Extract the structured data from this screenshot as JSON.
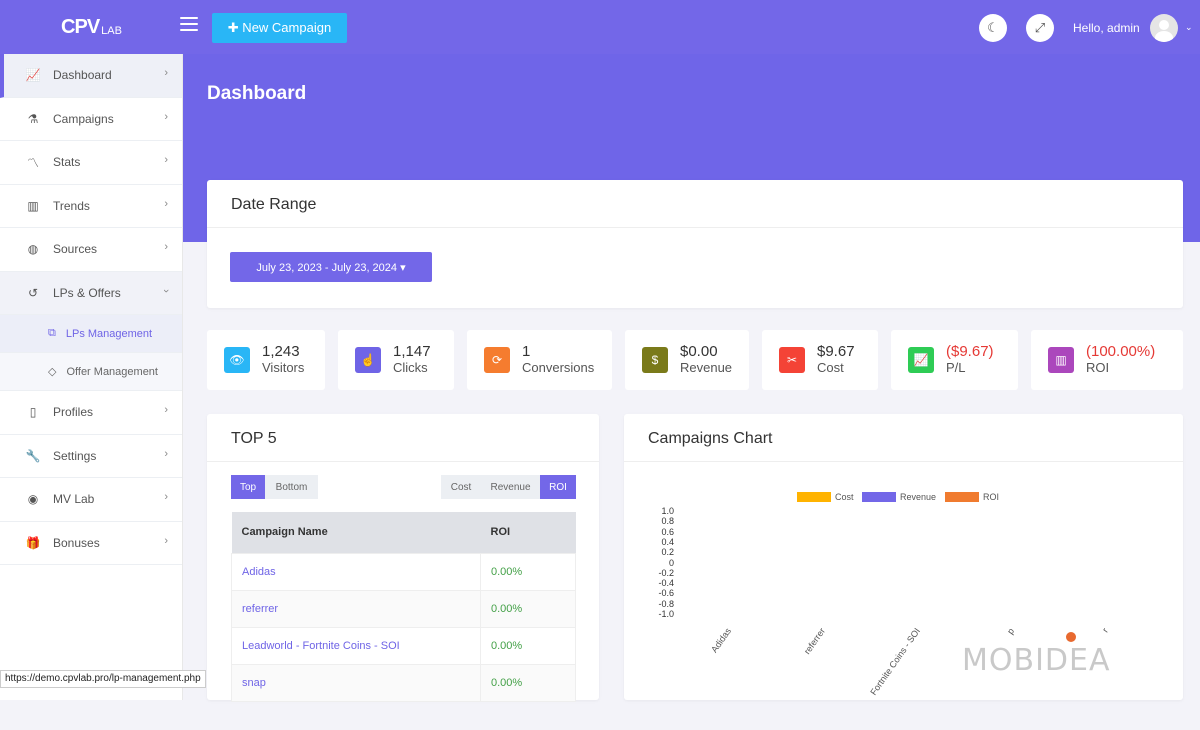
{
  "header": {
    "logo_text": "CPV",
    "logo_sub": "LAB",
    "new_campaign": "✚ New Campaign",
    "greeting": "Hello, admin"
  },
  "sidebar": {
    "items": [
      {
        "label": "Dashboard",
        "icon": "chart-line-icon"
      },
      {
        "label": "Campaigns",
        "icon": "flask-icon"
      },
      {
        "label": "Stats",
        "icon": "stats-icon"
      },
      {
        "label": "Trends",
        "icon": "trends-icon"
      },
      {
        "label": "Sources",
        "icon": "globe-icon"
      },
      {
        "label": "LPs & Offers",
        "icon": "history-icon"
      },
      {
        "label": "Profiles",
        "icon": "clipboard-icon"
      },
      {
        "label": "Settings",
        "icon": "wrench-icon"
      },
      {
        "label": "MV Lab",
        "icon": "mvlab-icon"
      },
      {
        "label": "Bonuses",
        "icon": "gift-icon"
      }
    ],
    "subitems": [
      {
        "label": "LPs Management"
      },
      {
        "label": "Offer Management"
      }
    ]
  },
  "page": {
    "title": "Dashboard"
  },
  "date_range": {
    "title": "Date Range",
    "button": "July 23, 2023 - July 23, 2024 ▾"
  },
  "stats": [
    {
      "value": "1,243",
      "label": "Visitors",
      "color": "#29b6f6"
    },
    {
      "value": "1,147",
      "label": "Clicks",
      "color": "#6f64e6"
    },
    {
      "value": "1",
      "label": "Conversions",
      "color": "#f57c2f"
    },
    {
      "value": "$0.00",
      "label": "Revenue",
      "color": "#7a7a1a"
    },
    {
      "value": "$9.67",
      "label": "Cost",
      "color": "#f44336"
    },
    {
      "value": "($9.67)",
      "label": "P/L",
      "color": "#2ecc55"
    },
    {
      "value": "(100.00%)",
      "label": "ROI",
      "color": "#ab47bc"
    }
  ],
  "top5": {
    "title": "TOP 5",
    "tabs": [
      "Top",
      "Bottom"
    ],
    "metric_tabs": [
      "Cost",
      "Revenue",
      "ROI"
    ],
    "columns": [
      "Campaign Name",
      "ROI"
    ],
    "rows": [
      {
        "name": "Adidas",
        "roi": "0.00%"
      },
      {
        "name": "referrer",
        "roi": "0.00%"
      },
      {
        "name": "Leadworld - Fortnite Coins - SOI",
        "roi": "0.00%"
      },
      {
        "name": "snap",
        "roi": "0.00%"
      }
    ]
  },
  "campaigns_chart": {
    "title": "Campaigns Chart"
  },
  "chart_data": {
    "type": "bar",
    "categories": [
      "Adidas",
      "referrer",
      "Fortnite Coins - SOI",
      "p",
      "r"
    ],
    "series": [
      {
        "name": "Cost",
        "color": "#ffb300",
        "values": [
          0,
          0,
          0,
          0,
          0
        ]
      },
      {
        "name": "Revenue",
        "color": "#7367e8",
        "values": [
          0,
          0,
          0,
          0,
          0
        ]
      },
      {
        "name": "ROI",
        "color": "#f07b2f",
        "values": [
          0,
          0,
          0,
          0,
          0
        ]
      }
    ],
    "yticks": [
      "1.0",
      "0.8",
      "0.6",
      "0.4",
      "0.2",
      "0",
      "-0.2",
      "-0.4",
      "-0.6",
      "-0.8",
      "-1.0"
    ],
    "ylim": [
      -1.0,
      1.0
    ],
    "legend": "top"
  },
  "watermark": "MOBIDEA",
  "status_url": "https://demo.cpvlab.pro/lp-management.php"
}
